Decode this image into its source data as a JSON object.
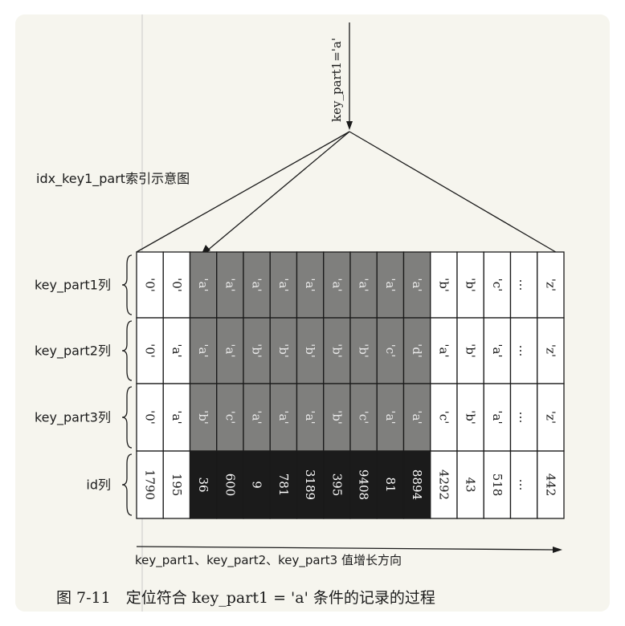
{
  "query_label": "key_part1='a'",
  "index_title": "idx_key1_part索引示意图",
  "row_labels": [
    "key_part1列",
    "key_part2列",
    "key_part3列",
    "id列"
  ],
  "columns": [
    {
      "k1": "'0'",
      "k2": "'0'",
      "k3": "'0'",
      "id": "1790",
      "match": false
    },
    {
      "k1": "'0'",
      "k2": "'a'",
      "k3": "'a'",
      "id": "195",
      "match": false
    },
    {
      "k1": "'a'",
      "k2": "'a'",
      "k3": "'b'",
      "id": "36",
      "match": true
    },
    {
      "k1": "'a'",
      "k2": "'a'",
      "k3": "'c'",
      "id": "600",
      "match": true
    },
    {
      "k1": "'a'",
      "k2": "'b'",
      "k3": "'a'",
      "id": "9",
      "match": true
    },
    {
      "k1": "'a'",
      "k2": "'b'",
      "k3": "'a'",
      "id": "781",
      "match": true
    },
    {
      "k1": "'a'",
      "k2": "'b'",
      "k3": "'a'",
      "id": "3189",
      "match": true
    },
    {
      "k1": "'a'",
      "k2": "'b'",
      "k3": "'b'",
      "id": "395",
      "match": true
    },
    {
      "k1": "'a'",
      "k2": "'b'",
      "k3": "'c'",
      "id": "9408",
      "match": true
    },
    {
      "k1": "'a'",
      "k2": "'c'",
      "k3": "'a'",
      "id": "81",
      "match": true
    },
    {
      "k1": "'a'",
      "k2": "'d'",
      "k3": "'a'",
      "id": "8894",
      "match": true
    },
    {
      "k1": "'b'",
      "k2": "'a'",
      "k3": "'c'",
      "id": "4292",
      "match": false
    },
    {
      "k1": "'b'",
      "k2": "'b'",
      "k3": "'b'",
      "id": "43",
      "match": false
    },
    {
      "k1": "'c'",
      "k2": "'a'",
      "k3": "'a'",
      "id": "518",
      "match": false
    },
    {
      "k1": "…",
      "k2": "…",
      "k3": "…",
      "id": "…",
      "match": false
    },
    {
      "k1": "'z'",
      "k2": "'z'",
      "k3": "'z'",
      "id": "442",
      "match": false
    }
  ],
  "axis_label": "key_part1、key_part2、key_part3 值增长方向",
  "caption": "图 7-11　定位符合 key_part1 = 'a' 条件的记录的过程",
  "colors": {
    "card": "#f6f5ee",
    "key_highlight": "#7f7f7d",
    "id_highlight": "#1b1b1b",
    "cell_plain": "#ffffff",
    "line": "#1a1a1a"
  }
}
